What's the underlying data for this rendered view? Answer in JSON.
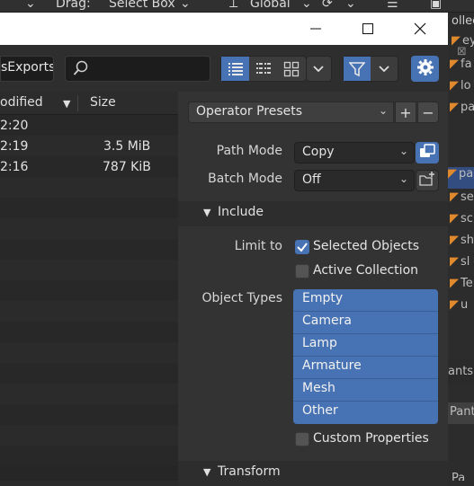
{
  "top_header": {
    "drag_label": "Drag:",
    "drag_value": "Select Box",
    "orientation_value": "Global"
  },
  "file_browser": {
    "path_text": "sExports\\",
    "search_placeholder": "",
    "columns": {
      "modified": "odified",
      "size": "Size"
    },
    "files": [
      {
        "modified": "2:20",
        "size": ""
      },
      {
        "modified": "2:19",
        "size": "3.5 MiB"
      },
      {
        "modified": "2:16",
        "size": "787 KiB"
      }
    ]
  },
  "operator": {
    "presets_label": "Operator Presets",
    "path_mode_label": "Path Mode",
    "path_mode_value": "Copy",
    "batch_mode_label": "Batch Mode",
    "batch_mode_value": "Off",
    "include_section": "Include",
    "limit_to_label": "Limit to",
    "selected_objects_label": "Selected Objects",
    "selected_objects_checked": true,
    "active_collection_label": "Active Collection",
    "active_collection_checked": false,
    "object_types_label": "Object Types",
    "object_types": [
      "Empty",
      "Camera",
      "Lamp",
      "Armature",
      "Mesh",
      "Other"
    ],
    "custom_properties_label": "Custom Properties",
    "custom_properties_checked": false,
    "transform_section": "Transform"
  },
  "right_panel": {
    "items": [
      "ey",
      "fa",
      "lo",
      "pa",
      "se",
      "sc",
      "sh",
      "sl",
      "Te",
      "u"
    ],
    "label_pants_1": "ants",
    "label_pants_2": "Pants",
    "label_pa": "Pa",
    "outliner_header": "ollec"
  },
  "colors": {
    "accent": "#4772b3",
    "panel": "#333333",
    "orange": "#e08a2d"
  }
}
